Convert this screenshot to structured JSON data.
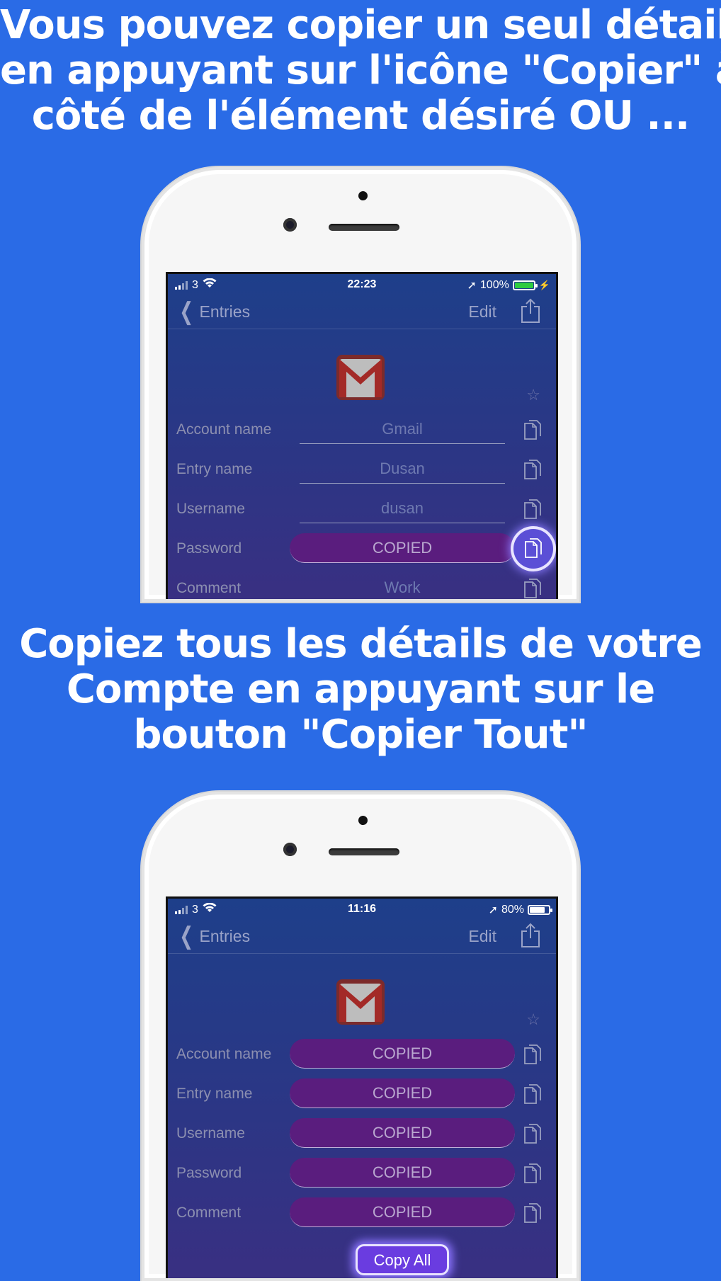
{
  "headline_top": {
    "line1": "Vous pouvez copier un seul détail",
    "line2_prefix": "en appuyant sur l'icône \"",
    "line2_bold": "Copier",
    "line2_suffix": "\" à",
    "line3": "côté de l'élément désiré OU ..."
  },
  "headline_middle": {
    "line1": "Copiez tous les détails de votre",
    "line2": "Compte en appuyant sur le",
    "line3_prefix": "bouton \"",
    "line3_bold": "Copier Tout",
    "line3_suffix": "\""
  },
  "phone1": {
    "status": {
      "carrier": "3",
      "time": "22:23",
      "battery_text": "100%",
      "battery_level": 1.0,
      "battery_color": "#2ecc40"
    },
    "nav": {
      "back_label": "Entries",
      "edit_label": "Edit"
    },
    "rows": [
      {
        "label": "Account name",
        "value": "Gmail",
        "copied": false
      },
      {
        "label": "Entry name",
        "value": "Dusan",
        "copied": false
      },
      {
        "label": "Username",
        "value": "dusan",
        "copied": false
      },
      {
        "label": "Password",
        "value": "COPIED",
        "copied": true
      },
      {
        "label": "Comment",
        "value": "Work",
        "copied": false
      }
    ]
  },
  "phone2": {
    "status": {
      "carrier": "3",
      "time": "11:16",
      "battery_text": "80%",
      "battery_level": 0.8,
      "battery_color": "#ffffff"
    },
    "nav": {
      "back_label": "Entries",
      "edit_label": "Edit"
    },
    "rows": [
      {
        "label": "Account name",
        "value": "COPIED",
        "copied": true
      },
      {
        "label": "Entry name",
        "value": "COPIED",
        "copied": true
      },
      {
        "label": "Username",
        "value": "COPIED",
        "copied": true
      },
      {
        "label": "Password",
        "value": "COPIED",
        "copied": true
      },
      {
        "label": "Comment",
        "value": "COPIED",
        "copied": true
      }
    ],
    "copy_all_label": "Copy All"
  },
  "icons": {
    "app": "gmail-icon",
    "copy": "copy-icon",
    "share": "share-icon",
    "star": "star-icon"
  },
  "colors": {
    "background": "#2a6be6",
    "copied_pill": "#5a1d7e",
    "highlight": "#5b4fd6"
  }
}
